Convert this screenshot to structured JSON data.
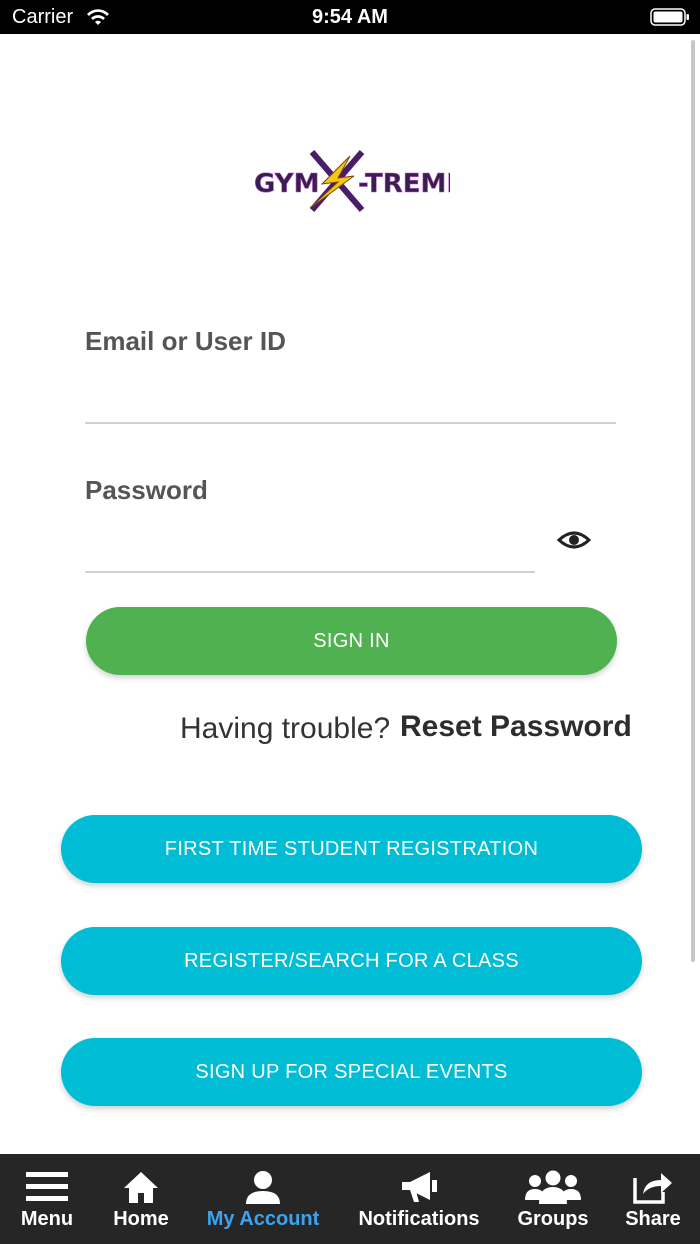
{
  "status_bar": {
    "carrier": "Carrier",
    "time": "9:54 AM"
  },
  "logo": {
    "text": "GYM X-TREME",
    "icon": "lightning-x-icon",
    "colors": {
      "text": "#3a1f4d",
      "bolt": "#f5c518",
      "x": "#4a1d6b"
    }
  },
  "form": {
    "email_label": "Email or User ID",
    "password_label": "Password",
    "sign_in_label": "SIGN IN",
    "trouble_text": "Having trouble?",
    "reset_link": "Reset Password"
  },
  "actions": [
    {
      "label": "FIRST TIME STUDENT REGISTRATION"
    },
    {
      "label": "REGISTER/SEARCH FOR A CLASS"
    },
    {
      "label": "SIGN UP FOR SPECIAL EVENTS"
    }
  ],
  "tab_bar": {
    "tabs": [
      {
        "label": "Menu",
        "icon": "hamburger-icon"
      },
      {
        "label": "Home",
        "icon": "home-icon"
      },
      {
        "label": "My Account",
        "icon": "user-icon",
        "active": true
      },
      {
        "label": "Notifications",
        "icon": "megaphone-icon"
      },
      {
        "label": "Groups",
        "icon": "group-icon"
      },
      {
        "label": "Share",
        "icon": "share-icon"
      }
    ]
  },
  "colors": {
    "sign_in_green": "#4fb150",
    "action_cyan": "#00bcd4",
    "active_tab": "#3ba3f0",
    "tab_bar_bg": "#262626"
  }
}
